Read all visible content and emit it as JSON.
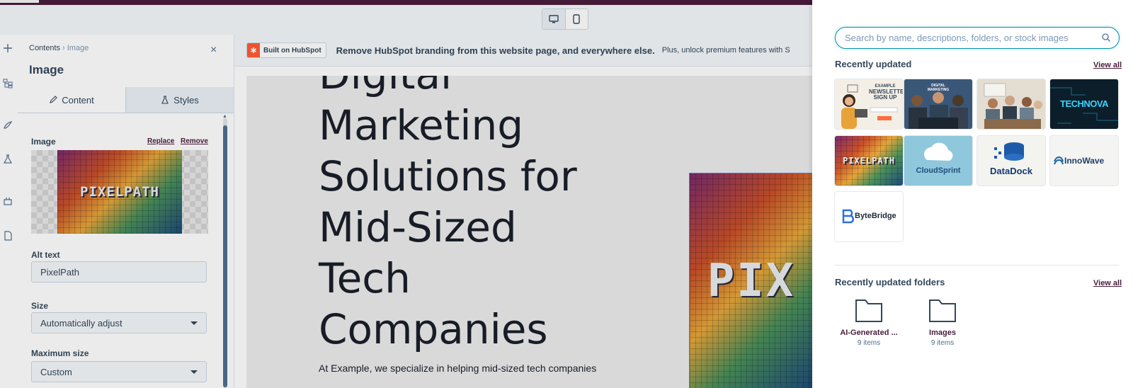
{
  "device_toggle": {
    "desktop_icon": "desktop-icon",
    "mobile_icon": "mobile-icon"
  },
  "left_rail": {
    "icons": [
      "plus-icon",
      "tree-icon",
      "brush-icon",
      "flask-icon",
      "plugin-icon",
      "file-icon"
    ]
  },
  "panel": {
    "breadcrumb_parent": "Contents",
    "breadcrumb_current": "Image",
    "title": "Image",
    "tabs": [
      {
        "label": "Content"
      },
      {
        "label": "Styles"
      }
    ],
    "image_label": "Image",
    "replace_label": "Replace",
    "remove_label": "Remove",
    "image_text": "PIXELPATH",
    "alt_label": "Alt text",
    "alt_value": "PixelPath",
    "size_label": "Size",
    "size_value": "Automatically adjust",
    "max_size_label": "Maximum size",
    "max_size_value": "Custom"
  },
  "banner": {
    "badge": "Built on HubSpot",
    "main": "Remove HubSpot branding from this website page, and everywhere else.",
    "sub": "Plus, unlock premium features with S"
  },
  "page": {
    "heading_lines": [
      "Digital",
      "Marketing",
      "Solutions for",
      "Mid-Sized",
      "Tech",
      "Companies"
    ],
    "body": "At Example, we specialize in helping mid-sized tech companies",
    "hero_image_text": "PIX"
  },
  "drawer": {
    "search_placeholder": "Search by name, descriptions, folders, or stock images",
    "recent_title": "Recently updated",
    "view_all": "View all",
    "thumbnails": [
      {
        "name": "newsletter",
        "lines": [
          "EXAMPLE",
          "NEWSLETTER",
          "SIGN UP"
        ]
      },
      {
        "name": "digital-marketing-team",
        "lines": [
          "DIGITAL",
          "MARKETING"
        ]
      },
      {
        "name": "team-meeting",
        "lines": []
      },
      {
        "name": "technova",
        "lines": [
          "TECHNOVA"
        ]
      },
      {
        "name": "pixelpath",
        "lines": [
          "PIXELPATH"
        ]
      },
      {
        "name": "cloudsprint",
        "lines": [
          "CloudSprint"
        ]
      },
      {
        "name": "datadock",
        "lines": [
          "DataDock"
        ]
      },
      {
        "name": "innowave",
        "lines": [
          "InnoWave"
        ]
      },
      {
        "name": "bytebridge",
        "lines": [
          "ByteBridge"
        ]
      }
    ],
    "folders_title": "Recently updated folders",
    "folders": [
      {
        "name": "AI-Generated ...",
        "count": "9 items"
      },
      {
        "name": "Images",
        "count": "9 items"
      }
    ]
  },
  "colors": {
    "brand_dark": "#4a1d3c",
    "accent_teal": "#0091ae",
    "hubspot_orange": "#ff5c35"
  }
}
